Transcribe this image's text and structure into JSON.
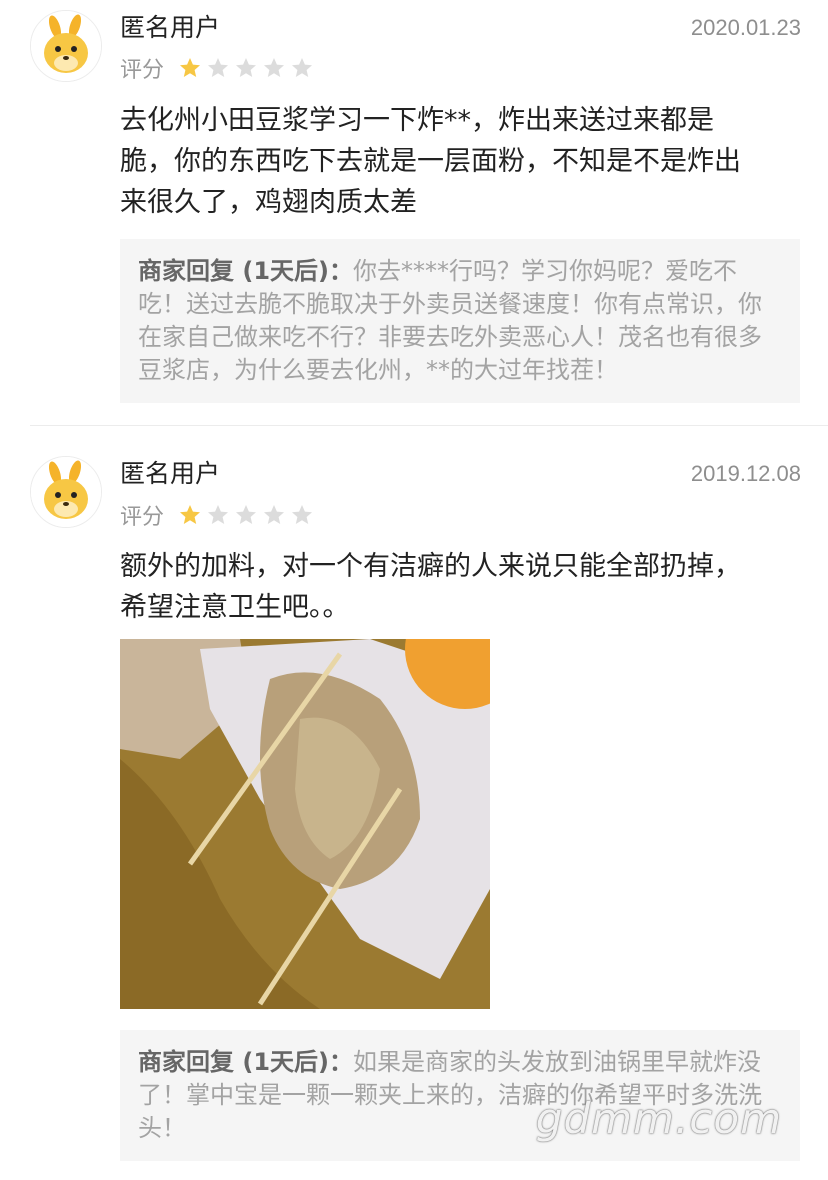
{
  "reviews": [
    {
      "username": "匿名用户",
      "date": "2020.01.23",
      "rating_label": "评分",
      "rating": 1,
      "max_rating": 5,
      "content_lines": [
        "去化州小田豆浆学习一下炸**，炸出来送过来都是",
        "脆，你的东西吃下去就是一层面粉，不知是不是炸出",
        "来很久了，鸡翅肉质太差"
      ],
      "reply_prefix": "商家回复 (1天后)：",
      "reply_text": "你去****行吗？学习你妈呢？爱吃不吃！送过去脆不脆取决于外卖员送餐速度！你有点常识，你在家自己做来吃不行？非要去吃外卖恶心人！茂名也有很多豆浆店，为什么要去化州，**的大过年找茬！"
    },
    {
      "username": "匿名用户",
      "date": "2019.12.08",
      "rating_label": "评分",
      "rating": 1,
      "max_rating": 5,
      "content_lines": [
        "额外的加料，对一个有洁癖的人来说只能全部扔掉，",
        "希望注意卫生吧。。"
      ],
      "reply_prefix": "商家回复 (1天后)：",
      "reply_text": "如果是商家的头发放到油锅里早就炸没了！掌中宝是一颗一颗夹上来的，洁癖的你希望平时多洗洗头！"
    }
  ],
  "watermark": "gdmm.com",
  "colors": {
    "star_on": "#f7c744",
    "star_off": "#dcdcdc",
    "reply_bg": "#f5f5f5"
  }
}
